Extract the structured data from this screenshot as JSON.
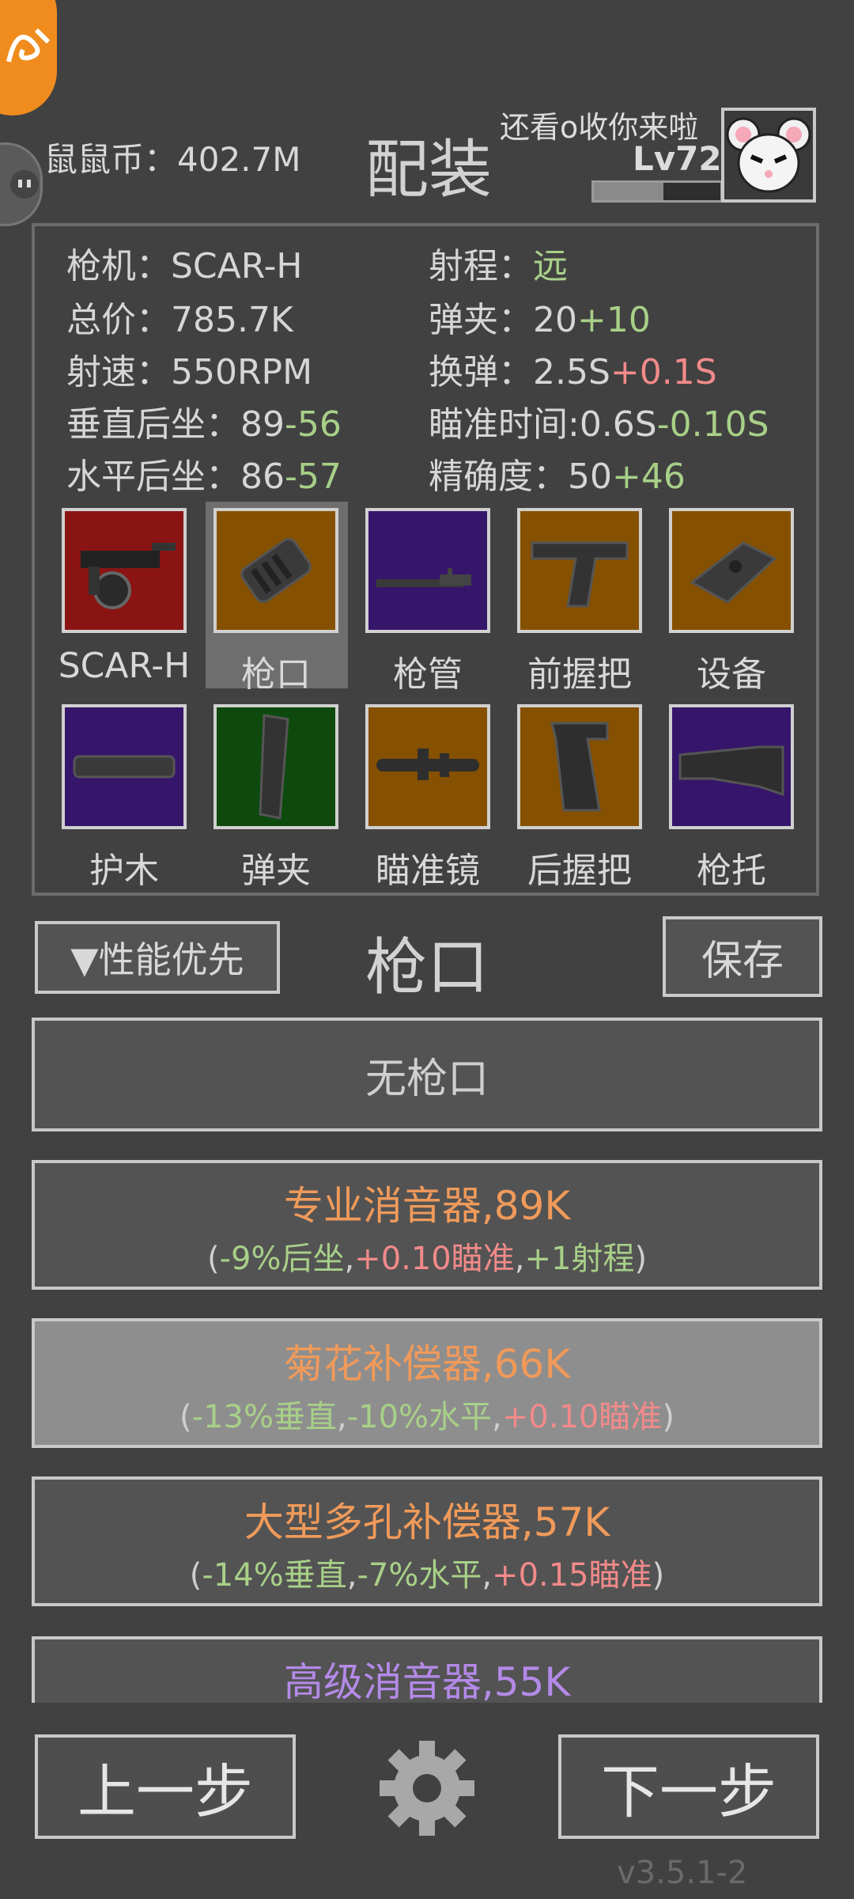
{
  "header": {
    "coins": "鼠鼠币：402.7M",
    "title": "配装",
    "player_name": "还看o收你来啦",
    "level": "Lv72",
    "xp_fraction": 0.55
  },
  "stats": {
    "gun": "枪机：SCAR-H",
    "price": "总价：785.7K",
    "fire_rate": "射速：550RPM",
    "vrecoil_label": "垂直后坐：89",
    "vrecoil_mod": "-56",
    "hrecoil_label": "水平后坐：86",
    "hrecoil_mod": "-57",
    "range_label": "射程：",
    "range_val": "远",
    "mag_label": "弹夹：20",
    "mag_mod": "+10",
    "reload_label": "换弹：2.5S",
    "reload_mod": "+0.1S",
    "aim_label": "瞄准时间:0.6S",
    "aim_mod": "-0.10S",
    "acc_label": "精确度：50",
    "acc_mod": "+46"
  },
  "slots": [
    {
      "label": "SCAR-H",
      "color": "#8a1414",
      "icon": "rifle-icon"
    },
    {
      "label": "枪口",
      "color": "#855000",
      "icon": "muzzle-icon"
    },
    {
      "label": "枪管",
      "color": "#36166a",
      "icon": "barrel-icon"
    },
    {
      "label": "前握把",
      "color": "#855000",
      "icon": "foregrip-icon"
    },
    {
      "label": "设备",
      "color": "#855000",
      "icon": "device-icon"
    },
    {
      "label": "护木",
      "color": "#36166a",
      "icon": "handguard-icon"
    },
    {
      "label": "弹夹",
      "color": "#0e4a0e",
      "icon": "magazine-icon"
    },
    {
      "label": "瞄准镜",
      "color": "#855000",
      "icon": "scope-icon"
    },
    {
      "label": "后握把",
      "color": "#855000",
      "icon": "pistol-grip-icon"
    },
    {
      "label": "枪托",
      "color": "#36166a",
      "icon": "stock-icon"
    }
  ],
  "controls": {
    "sort": "▼性能优先",
    "section": "枪口",
    "save": "保存"
  },
  "options": [
    {
      "name": "无枪口"
    },
    {
      "name": "专业消音器,89K",
      "d1": "(",
      "d2": "-9%后坐",
      "d3": ",",
      "d4": "+0.10瞄准",
      "d5": ",",
      "d6": "+1射程",
      "d7": ")"
    },
    {
      "name": "菊花补偿器,66K",
      "d1": "(",
      "d2": "-13%垂直",
      "d3": ",",
      "d4": "-10%水平",
      "d5": ",",
      "d6": "+0.10瞄准",
      "d7": ")"
    },
    {
      "name": "大型多孔补偿器,57K",
      "d1": "(",
      "d2": "-14%垂直",
      "d3": ",",
      "d4": "-7%水平",
      "d5": ",",
      "d6": "+0.15瞄准",
      "d7": ")"
    },
    {
      "name": "高级消音器,55K"
    }
  ],
  "footer": {
    "prev": "上一步",
    "next": "下一步",
    "version": "v3.5.1-2"
  },
  "colors": {
    "orange_text": "#f09a5a",
    "purple_text": "#b48ae8",
    "green_mod": "#a8d088",
    "red_mod": "#f28a8a"
  }
}
